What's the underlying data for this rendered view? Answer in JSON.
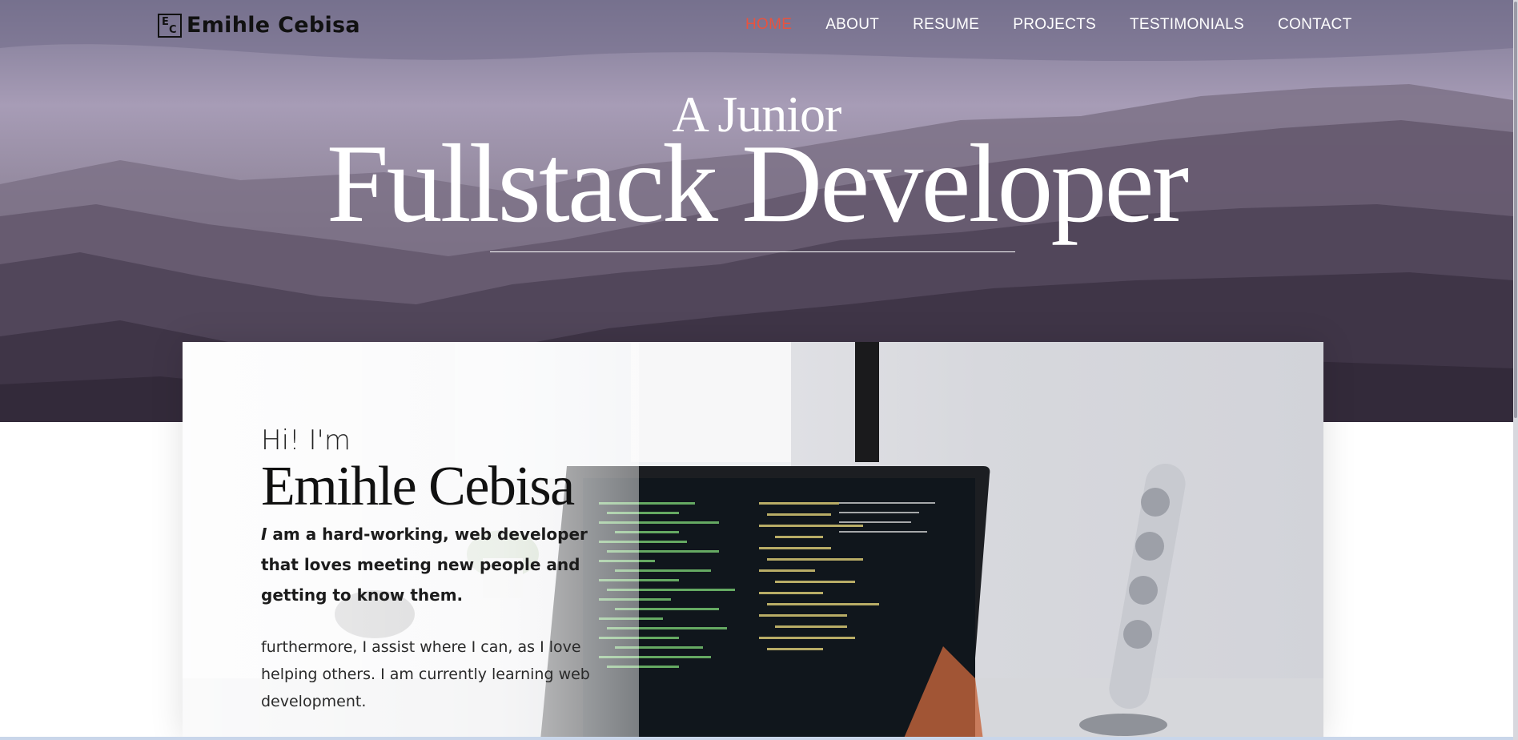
{
  "brand": {
    "logo_mark_e": "E",
    "logo_mark_c": "C",
    "name": "Emihle Cebisa"
  },
  "nav": {
    "items": [
      {
        "label": "HOME",
        "active": true
      },
      {
        "label": "ABOUT",
        "active": false
      },
      {
        "label": "RESUME",
        "active": false
      },
      {
        "label": "PROJECTS",
        "active": false
      },
      {
        "label": "TESTIMONIALS",
        "active": false
      },
      {
        "label": "CONTACT",
        "active": false
      }
    ],
    "active_color": "#e8533f"
  },
  "hero": {
    "subtitle": "A Junior",
    "title": "Fullstack Developer"
  },
  "intro": {
    "greeting": "Hi! I'm",
    "name": "Emihle Cebisa",
    "tagline_em": "I",
    "tagline_rest": " am a hard-working, web developer that loves meeting new people and getting to know them.",
    "body": "furthermore, I assist where I can, as I love helping others. I am currently learning web development."
  }
}
